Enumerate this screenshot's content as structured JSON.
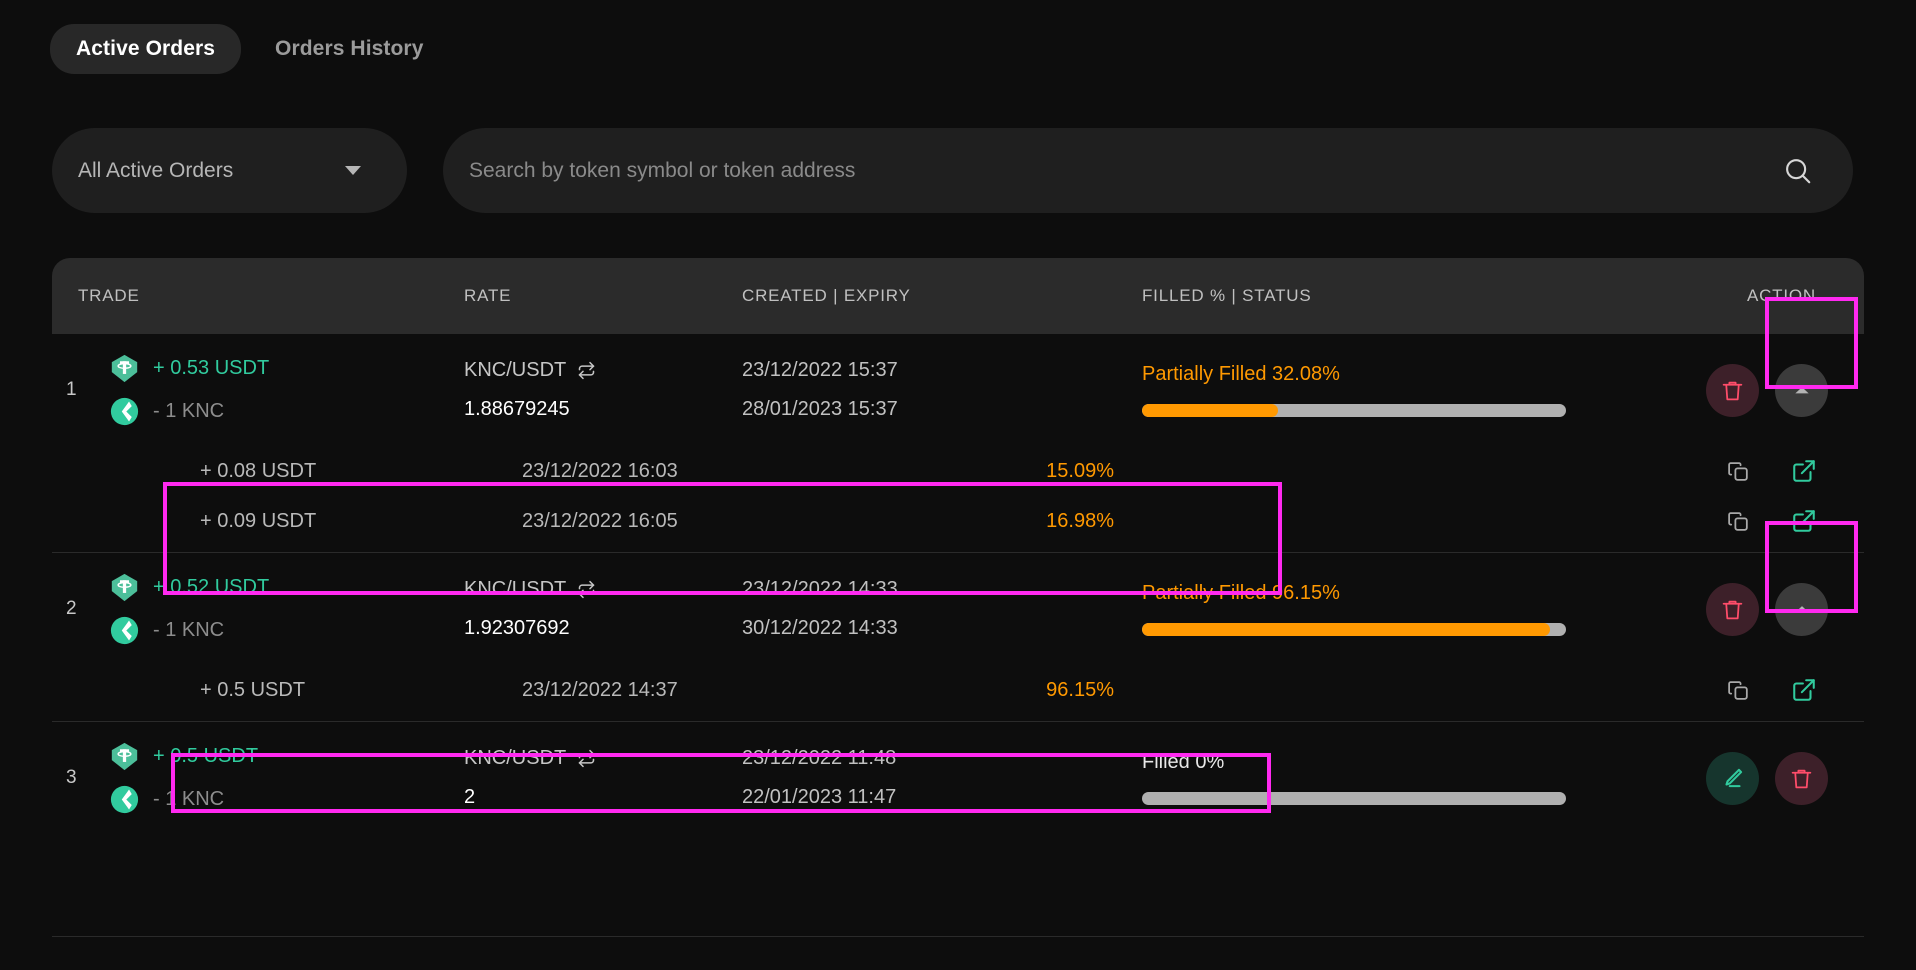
{
  "tabs": [
    {
      "label": "Active Orders",
      "active": true
    },
    {
      "label": "Orders History",
      "active": false
    }
  ],
  "filter": {
    "label": "All Active Orders",
    "icon": "chevron-down-icon"
  },
  "search": {
    "value": "",
    "placeholder": "Search by token symbol or token address",
    "icon": "search-icon"
  },
  "table": {
    "columns": {
      "trade": "TRADE",
      "rate": "RATE",
      "dates": "CREATED | EXPIRY",
      "status": "FILLED % | STATUS",
      "action": "ACTION"
    },
    "orders": [
      {
        "index": "1",
        "buy": {
          "amount": "+ 0.53 USDT",
          "token": "USDT"
        },
        "sell": {
          "amount": "- 1 KNC",
          "token": "KNC"
        },
        "pair": "KNC/USDT",
        "rate": "1.88679245",
        "created": "23/12/2022 15:37",
        "expiry": "28/01/2023 15:37",
        "status": "Partially Filled 32.08%",
        "status_type": "partial",
        "filled_percent": 32.08,
        "actions": [
          "delete-button",
          "collapse-button"
        ],
        "expanded": true,
        "fills": [
          {
            "amount": "+ 0.08 USDT",
            "date": "23/12/2022 16:03",
            "percent": "15.09%"
          },
          {
            "amount": "+ 0.09 USDT",
            "date": "23/12/2022 16:05",
            "percent": "16.98%"
          }
        ]
      },
      {
        "index": "2",
        "buy": {
          "amount": "+ 0.52 USDT",
          "token": "USDT"
        },
        "sell": {
          "amount": "- 1 KNC",
          "token": "KNC"
        },
        "pair": "KNC/USDT",
        "rate": "1.92307692",
        "created": "23/12/2022 14:33",
        "expiry": "30/12/2022 14:33",
        "status": "Partially Filled 96.15%",
        "status_type": "partial",
        "filled_percent": 96.15,
        "actions": [
          "delete-button",
          "collapse-button"
        ],
        "expanded": true,
        "fills": [
          {
            "amount": "+ 0.5 USDT",
            "date": "23/12/2022 14:37",
            "percent": "96.15%"
          }
        ]
      },
      {
        "index": "3",
        "buy": {
          "amount": "+ 0.5 USDT",
          "token": "USDT"
        },
        "sell": {
          "amount": "- 1 KNC",
          "token": "KNC"
        },
        "pair": "KNC/USDT",
        "rate": "2",
        "created": "23/12/2022 11:48",
        "expiry": "22/01/2023 11:47",
        "status": "Filled 0%",
        "status_type": "open",
        "filled_percent": 0,
        "actions": [
          "edit-button",
          "delete-button"
        ],
        "expanded": false,
        "fills": []
      }
    ]
  },
  "colors": {
    "background": "#0d0d0d",
    "header_row": "#2b2b2b",
    "accent_green": "#31cb9e",
    "accent_orange": "#ff9901",
    "accent_red": "#ff4d6a",
    "highlight_box": "#ff29f0",
    "bar_track": "#b0b0b0"
  },
  "icon_names": {
    "search": "search-icon",
    "dropdown": "chevron-down-icon",
    "swap": "swap-arrows-icon",
    "delete": "trash-icon",
    "edit": "pencil-icon",
    "collapse": "chevron-up-icon",
    "copy": "copy-icon",
    "external": "external-link-icon",
    "usdt": "usdt-token-icon",
    "knc": "knc-token-icon"
  }
}
